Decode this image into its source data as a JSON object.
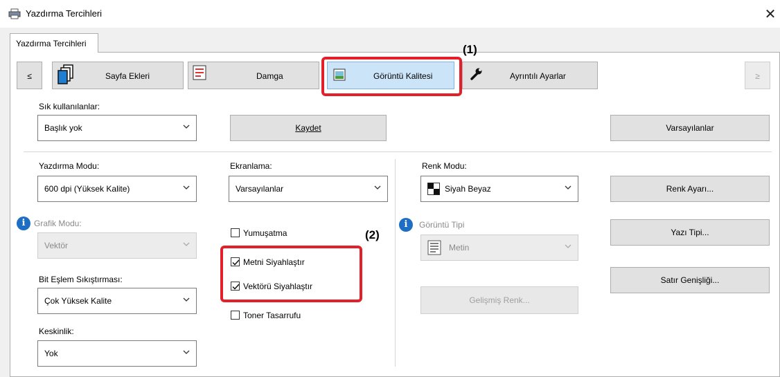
{
  "window": {
    "title": "Yazdırma Tercihleri",
    "close_glyph": "✕"
  },
  "outer_tab": {
    "label": "Yazdırma Tercihleri"
  },
  "tabs": {
    "prev_glyph": "≤",
    "next_glyph": "≥",
    "items": [
      {
        "label": "Sayfa Ekleri",
        "icon": "pages-icon"
      },
      {
        "label": "Damga",
        "icon": "stamp-icon"
      },
      {
        "label": "Görüntü Kalitesi",
        "icon": "image-quality-icon",
        "selected": true
      },
      {
        "label": "Ayrıntılı Ayarlar",
        "icon": "wrench-icon"
      }
    ]
  },
  "callouts": {
    "one": "(1)",
    "two": "(2)"
  },
  "favorites": {
    "label": "Sık kullanılanlar:",
    "value": "Başlık yok",
    "save_label": "Kaydet",
    "defaults_label": "Varsayılanlar"
  },
  "print_mode": {
    "label": "Yazdırma Modu:",
    "value": "600 dpi (Yüksek Kalite)"
  },
  "graphics_mode": {
    "label": "Grafik Modu:",
    "value": "Vektör"
  },
  "bitmap_compression": {
    "label": "Bit Eşlem Sıkıştırması:",
    "value": "Çok Yüksek Kalite"
  },
  "sharpness": {
    "label": "Keskinlik:",
    "value": "Yok"
  },
  "screening": {
    "label": "Ekranlama:",
    "value": "Varsayılanlar"
  },
  "checkboxes": {
    "smoothing": {
      "label": "Yumuşatma",
      "checked": false
    },
    "text_to_black": {
      "label": "Metni Siyahlaştır",
      "checked": true
    },
    "vector_to_black": {
      "label": "Vektörü Siyahlaştır",
      "checked": true
    },
    "toner_save": {
      "label": "Toner Tasarrufu",
      "checked": false
    }
  },
  "color_mode": {
    "label": "Renk Modu:",
    "value": "Siyah Beyaz"
  },
  "image_type": {
    "label": "Görüntü Tipi",
    "value": "Metin"
  },
  "advanced_color": {
    "label": "Gelişmiş Renk..."
  },
  "right_buttons": {
    "color_adjust": "Renk Ayarı...",
    "font": "Yazı Tipi...",
    "line_width": "Satır Genişliği..."
  },
  "colors": {
    "highlight": "#e3202a",
    "selected_tab": "#cce4f7",
    "info": "#1e6fc4"
  }
}
